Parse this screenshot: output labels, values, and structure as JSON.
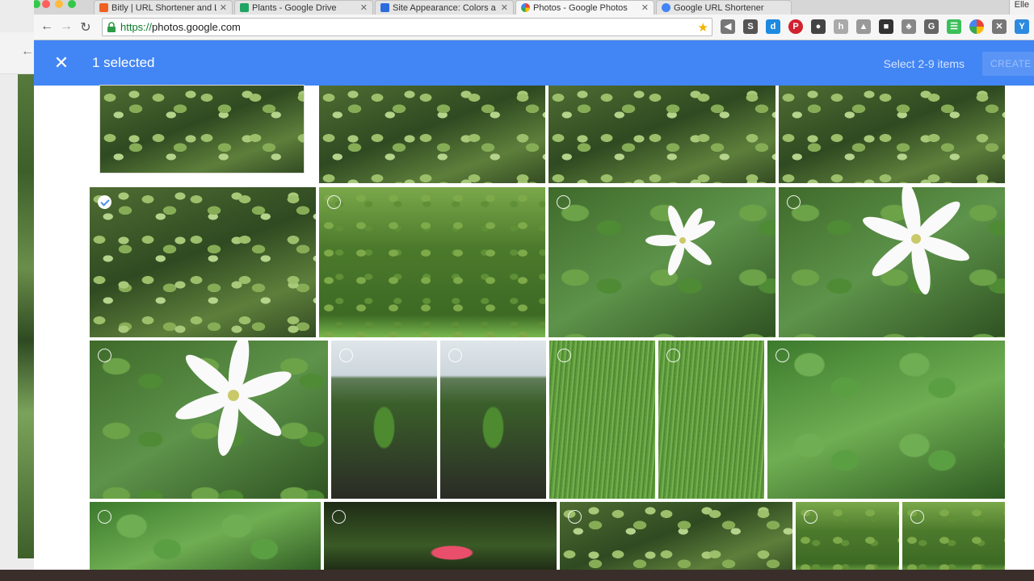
{
  "browser": {
    "tabs": [
      {
        "title": "Bitly | URL Shortener and L",
        "favicon_color": "#ee6123",
        "favicon_icon": "bitly-icon"
      },
      {
        "title": "Plants - Google Drive",
        "favicon_color": "#1fa463",
        "favicon_icon": "drive-icon"
      },
      {
        "title": "Site Appearance: Colors a",
        "favicon_color": "#2d6cdf",
        "favicon_icon": "page-icon"
      },
      {
        "title": "Photos - Google Photos",
        "favicon_color": "#ea4335",
        "favicon_icon": "photos-pinwheel-icon"
      },
      {
        "title": "Google URL Shortener",
        "favicon_color": "#4285f4",
        "favicon_icon": "google-icon"
      }
    ],
    "active_tab": 3,
    "user_name": "Elle",
    "url_scheme": "https://",
    "url_host": "photos.google.com"
  },
  "selection_bar": {
    "close_icon": "close-x-icon",
    "count_text": "1 selected",
    "hint_text": "Select 2-9 items",
    "create_label": "CREATE",
    "bg_color": "#4285f4"
  },
  "photos": {
    "rows": [
      {
        "items": [
          {
            "kind": "leaves",
            "selected": false,
            "label": "top-row-photo"
          },
          {
            "kind": "leaves",
            "selected": false,
            "label": "top-row-photo"
          },
          {
            "kind": "leaves",
            "selected": false,
            "label": "top-row-photo"
          },
          {
            "kind": "leaves",
            "selected": false,
            "label": "top-row-photo"
          }
        ]
      },
      {
        "items": [
          {
            "kind": "leaves",
            "selected": true
          },
          {
            "kind": "bush",
            "selected": false
          },
          {
            "kind": "flower",
            "selected": false
          },
          {
            "kind": "flower",
            "selected": false
          }
        ]
      },
      {
        "items": [
          {
            "kind": "flower",
            "selected": false
          },
          {
            "kind": "banana",
            "selected": false
          },
          {
            "kind": "banana",
            "selected": false
          },
          {
            "kind": "grass",
            "selected": false
          },
          {
            "kind": "grass",
            "selected": false
          },
          {
            "kind": "taro",
            "selected": false
          }
        ]
      },
      {
        "items": [
          {
            "kind": "taro",
            "selected": false
          },
          {
            "kind": "dark",
            "selected": false
          },
          {
            "kind": "leaves",
            "selected": false
          },
          {
            "kind": "bush",
            "selected": false
          },
          {
            "kind": "bush",
            "selected": false
          }
        ]
      }
    ]
  }
}
